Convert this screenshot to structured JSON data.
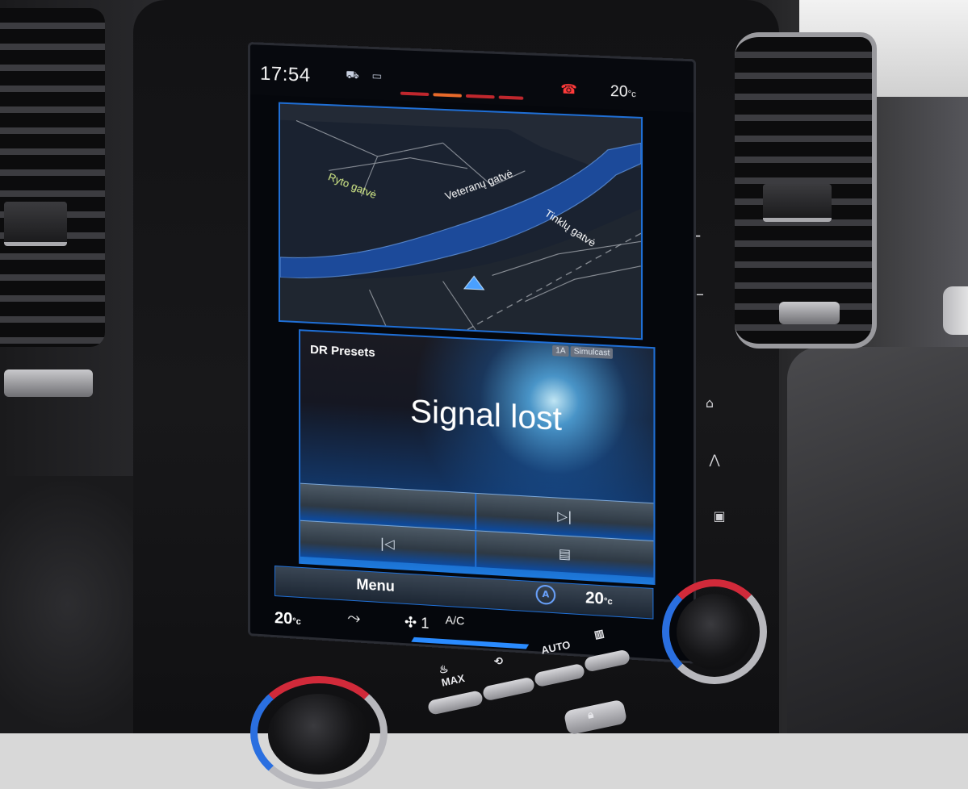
{
  "status_bar": {
    "time": "17:54",
    "temperature": "20",
    "temperature_unit": "°c"
  },
  "map": {
    "streets": [
      "Ryto gatvė",
      "Veteranų gatvė",
      "Tinklų gatvė"
    ]
  },
  "radio": {
    "title": "DR Presets",
    "badge_a": "1A",
    "badge_b": "Simulcast",
    "message": "Signal lost",
    "prev_icon": "skip-back-icon",
    "next_icon": "skip-forward-icon",
    "list_icon": "list-icon"
  },
  "climate": {
    "menu_label": "Menu",
    "left_temp": "20",
    "right_temp": "20",
    "temp_unit": "°c",
    "fan_level": "1",
    "ac_label": "A/C",
    "auto_letter": "A"
  },
  "physical_buttons": {
    "auto_label": "AUTO",
    "max_label": "MAX"
  },
  "colors": {
    "accent": "#1f6fd6",
    "alert": "#ff3a3a"
  }
}
